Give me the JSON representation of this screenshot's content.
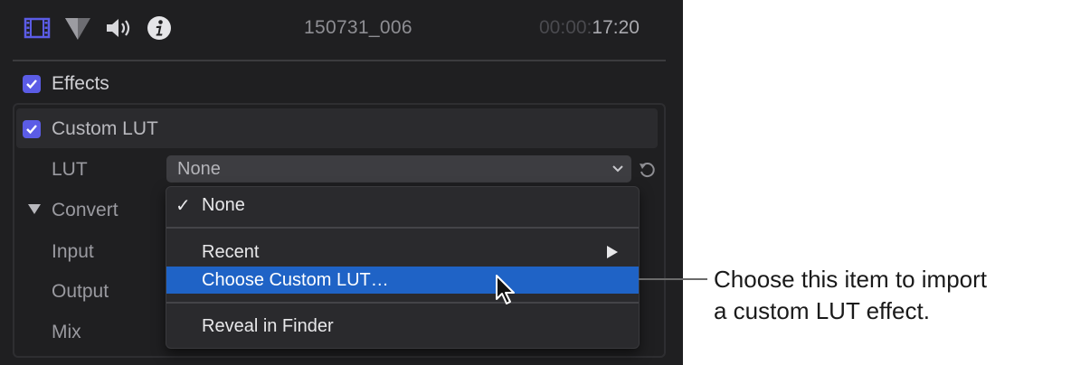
{
  "toolbar": {
    "icons": [
      "video-inspector-icon",
      "color-inspector-icon",
      "audio-inspector-icon",
      "info-inspector-icon"
    ],
    "clip_name": "150731_006",
    "timecode_dim": "00:00:",
    "timecode_bright": "17:20"
  },
  "effects": {
    "label": "Effects",
    "checked": true
  },
  "custom_lut": {
    "label": "Custom LUT",
    "checked": true,
    "lut_label": "LUT",
    "lut_value": "None",
    "convert_label": "Convert",
    "input_label": "Input",
    "output_label": "Output",
    "mix_label": "Mix"
  },
  "lut_menu": {
    "items": [
      {
        "label": "None",
        "checked": true
      },
      {
        "label": "Recent",
        "submenu": true
      },
      {
        "label": "Choose Custom LUT…",
        "highlighted": true
      },
      {
        "label": "Reveal in Finder"
      }
    ]
  },
  "callout": {
    "line1": "Choose this item to import",
    "line2": "a custom LUT effect."
  },
  "colors": {
    "accent_checkbox": "#5b5ce6",
    "menu_highlight": "#1f63c6",
    "inspector_icon": "#5b5ce6",
    "panel_bg": "#1f1f21"
  }
}
